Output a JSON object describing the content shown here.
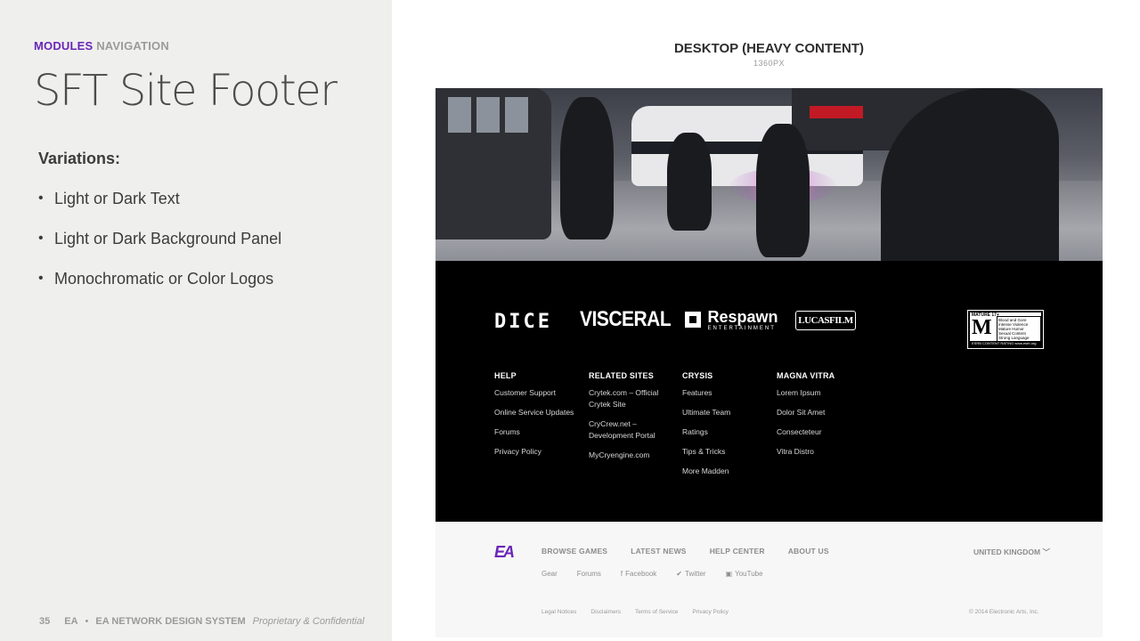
{
  "header": {
    "module_label": "MODULES",
    "section_label": "NAVIGATION",
    "title": "SFT Site Footer"
  },
  "variations": {
    "heading": "Variations:",
    "items": [
      "Light or Dark Text",
      "Light or Dark Background Panel",
      "Monochromatic or Color Logos"
    ]
  },
  "slide_footer": {
    "page_number": "35",
    "brand": "EA",
    "system": "EA NETWORK DESIGN SYSTEM",
    "confidential": "Proprietary & Confidential"
  },
  "preview": {
    "title": "DESKTOP (HEAVY CONTENT)",
    "width_label": "1360PX"
  },
  "logos": {
    "dice": "DICE",
    "visceral": "VISCERAL",
    "respawn": "Respawn",
    "respawn_sub": "ENTERTAINMENT",
    "lucasfilm": "LUCASFILM",
    "rating": {
      "top": "MATURE 17+",
      "letter": "M",
      "descriptors": "Blood and Gore\nIntense Violence\nMature Humor\nSexual Content\nStrong Language",
      "bottom": "ESRB CONTENT RATING   www.esrb.org"
    }
  },
  "columns": [
    {
      "heading": "HELP",
      "links": [
        "Customer Support",
        "Online Service Updates",
        "Forums",
        "Privacy Policy"
      ]
    },
    {
      "heading": "RELATED SITES",
      "links": [
        "Crytek.com – Official Crytek Site",
        "CryCrew.net – Development Portal",
        "MyCryengine.com"
      ]
    },
    {
      "heading": "CRYSIS",
      "links": [
        "Features",
        "Ultimate Team",
        "Ratings",
        "Tips & Tricks",
        "More Madden"
      ]
    },
    {
      "heading": "MAGNA VITRA",
      "links": [
        "Lorem Ipsum",
        "Dolor Sit Amet",
        "Consecteteur",
        "Vitra Distro"
      ]
    }
  ],
  "light_footer": {
    "logo": "EA",
    "nav": [
      "BROWSE GAMES",
      "LATEST NEWS",
      "HELP CENTER",
      "ABOUT US"
    ],
    "region": "UNITED KINGDOM",
    "sub_nav": [
      {
        "icon": "",
        "label": "Gear"
      },
      {
        "icon": "",
        "label": "Forums"
      },
      {
        "icon": "f",
        "label": "Facebook"
      },
      {
        "icon": "✔",
        "label": "Twitter"
      },
      {
        "icon": "▣",
        "label": "YouTube"
      }
    ],
    "legal": [
      "Legal Notices",
      "Disclaimers",
      "Terms of Service",
      "Privacy Policy"
    ],
    "copyright": "© 2014 Electronic Arts, Inc."
  },
  "colors": {
    "accent": "#6a26b8",
    "panel": "#efefee",
    "dark_footer": "#000000",
    "light_footer": "#f7f7f7"
  }
}
